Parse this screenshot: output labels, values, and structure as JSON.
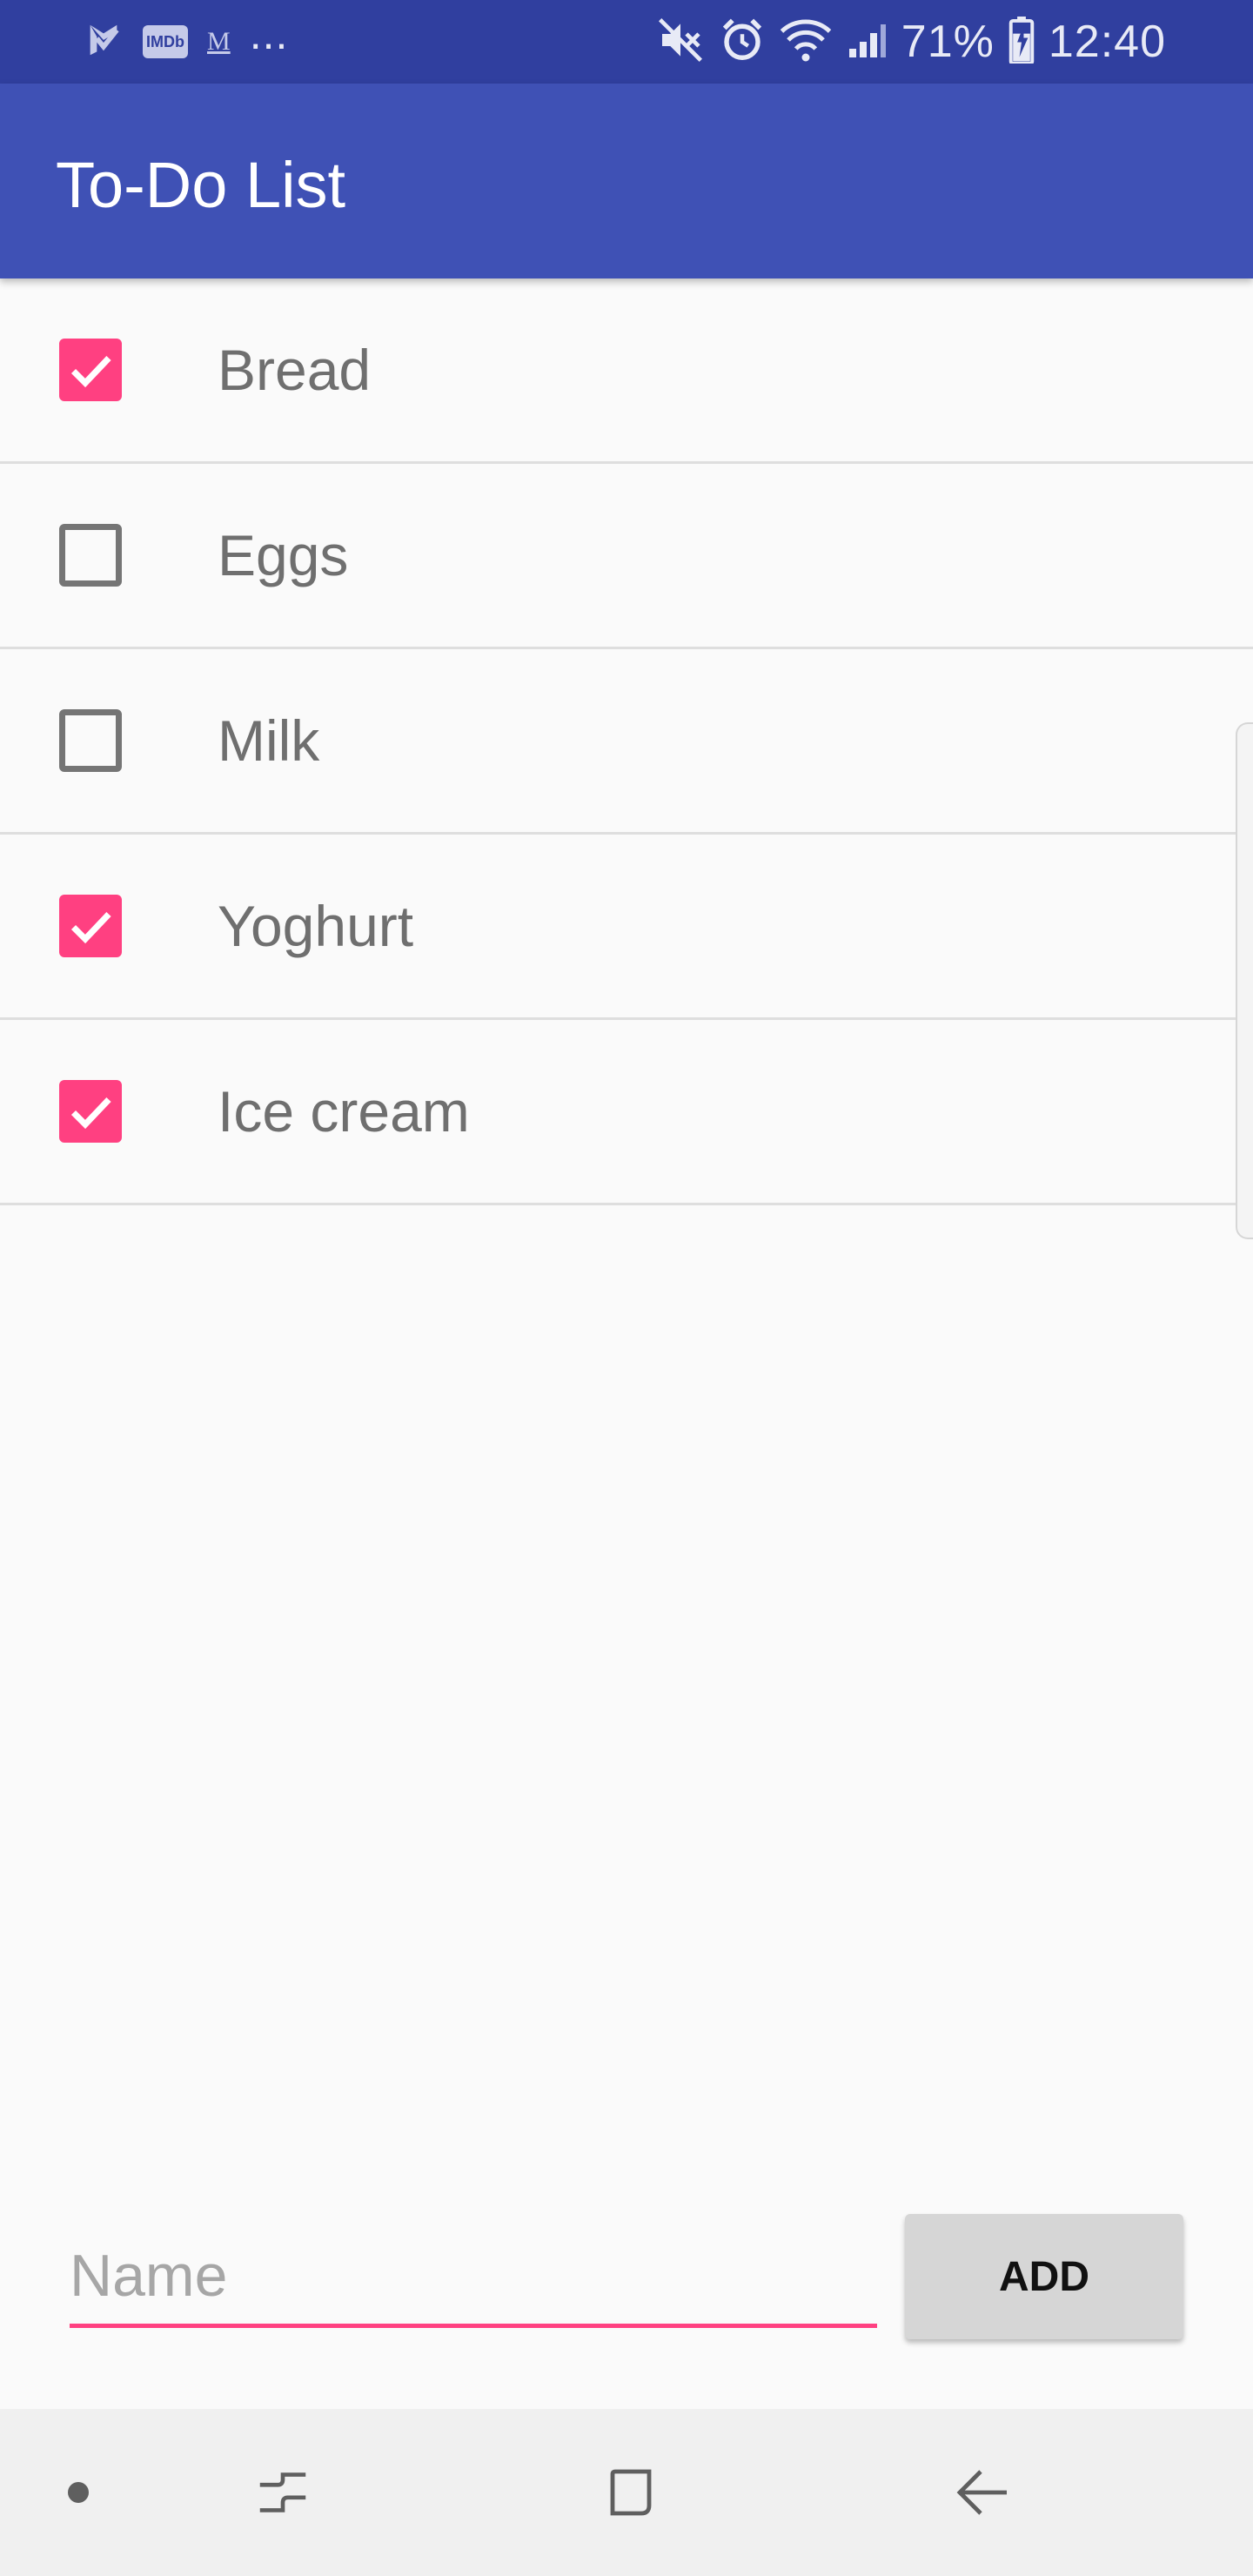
{
  "status_bar": {
    "left_icons": [
      "checkmark-flag-icon",
      "imdb-icon",
      "gmail-icon"
    ],
    "imdb_label": "IMDb",
    "gmail_label": "M",
    "more": "...",
    "right_icons": [
      "mute-icon",
      "alarm-icon",
      "wifi-icon",
      "signal-icon"
    ],
    "battery_percent": "71%",
    "time": "12:40"
  },
  "app_bar": {
    "title": "To-Do List"
  },
  "todo_items": [
    {
      "label": "Bread",
      "checked": true
    },
    {
      "label": "Eggs",
      "checked": false
    },
    {
      "label": "Milk",
      "checked": false
    },
    {
      "label": "Yoghurt",
      "checked": true
    },
    {
      "label": "Ice cream",
      "checked": true
    }
  ],
  "input": {
    "placeholder": "Name",
    "value": ""
  },
  "add_button": {
    "label": "ADD"
  },
  "nav_bar": {
    "buttons": [
      "dot-icon",
      "recent-apps-icon",
      "home-icon",
      "back-icon"
    ]
  },
  "colors": {
    "status_bar": "#303f9f",
    "app_bar": "#3f51b5",
    "accent": "#ff4081",
    "background": "#fafafa"
  }
}
